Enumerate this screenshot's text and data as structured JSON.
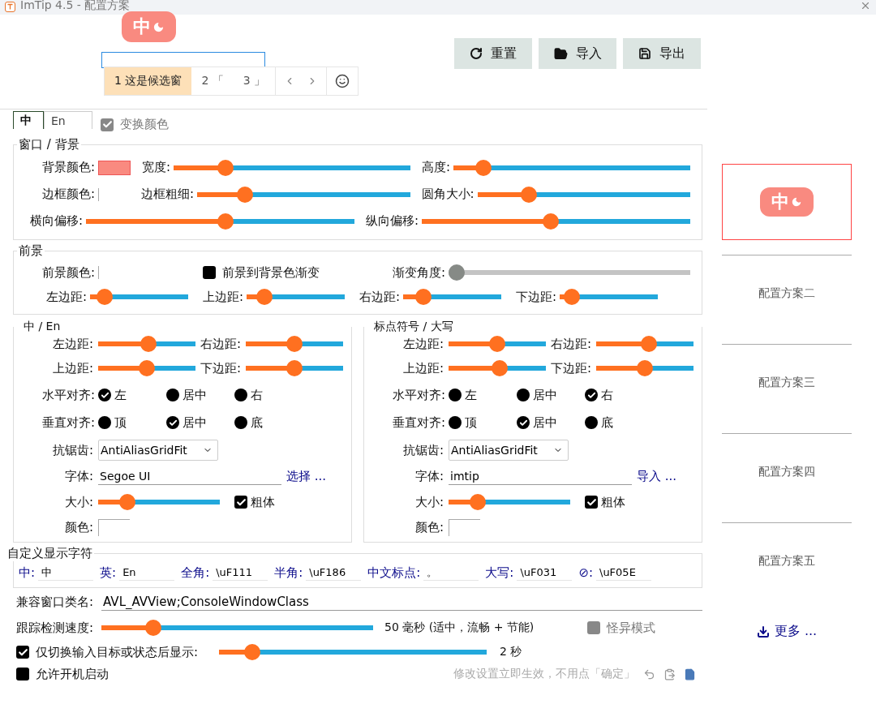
{
  "window": {
    "title": "ImTip 4.5 - 配置方案"
  },
  "badge": {
    "text": "中"
  },
  "candidates": [
    {
      "index": "1",
      "text": "这是候选窗",
      "selected": true
    },
    {
      "index": "2",
      "text": "「",
      "selected": false
    },
    {
      "index": "3",
      "text": "」",
      "selected": false
    }
  ],
  "toolbar": [
    {
      "kind": "reset",
      "label": "重置"
    },
    {
      "kind": "import",
      "label": "导入"
    },
    {
      "kind": "export",
      "label": "导出"
    }
  ],
  "tabs": [
    {
      "label": "中",
      "selected": true
    },
    {
      "label": "En",
      "selected": false
    }
  ],
  "swap_color": {
    "label": "变换颜色",
    "checked": true,
    "disabled": true
  },
  "background": {
    "title": "窗口 / 背景",
    "rows": [
      [
        {
          "kind": "color",
          "label": "背景颜色:",
          "color": "#f98a80"
        },
        {
          "kind": "slider",
          "label": "宽度:",
          "level": 0.2
        },
        {
          "kind": "slider",
          "label": "高度:",
          "level": 0.1
        }
      ],
      [
        {
          "kind": "color",
          "label": "边框颜色:",
          "color": "#ffffff"
        },
        {
          "kind": "slider",
          "label": "边框粗细:",
          "level": 0.2
        },
        {
          "kind": "slider",
          "label": "圆角大小:",
          "level": 0.22
        }
      ],
      [
        {
          "kind": "slider",
          "label": "横向偏移:",
          "level": 0.52
        },
        {
          "kind": "slider",
          "label": "纵向偏移:",
          "level": 0.48
        }
      ]
    ]
  },
  "foreground": {
    "title": "前景",
    "rows": [
      [
        {
          "kind": "color",
          "label": "前景颜色:",
          "color": "#ffffff"
        },
        {
          "kind": "checkbox",
          "label": "前景到背景色渐变",
          "checked": false
        },
        {
          "kind": "slider",
          "label": "渐变角度:",
          "level": 0,
          "disabled": true
        }
      ],
      [
        {
          "kind": "slider",
          "label": "左边距:",
          "level": 0.08
        },
        {
          "kind": "slider",
          "label": "上边距:",
          "level": 0.12
        },
        {
          "kind": "slider",
          "label": "右边距:",
          "level": 0.15
        },
        {
          "kind": "slider",
          "label": "下边距:",
          "level": 0.05
        }
      ]
    ]
  },
  "text_panels": [
    {
      "title": "中 / En",
      "margins": [
        {
          "label": "左边距:",
          "level": 0.52
        },
        {
          "label": "右边距:",
          "level": 0.5
        },
        {
          "label": "上边距:",
          "level": 0.5
        },
        {
          "label": "下边距:",
          "level": 0.5
        }
      ],
      "h_align": {
        "label": "水平对齐:",
        "options": [
          {
            "label": "左",
            "selected": true
          },
          {
            "label": "居中",
            "selected": false
          },
          {
            "label": "右",
            "selected": false
          }
        ]
      },
      "v_align": {
        "label": "垂直对齐:",
        "options": [
          {
            "label": "顶",
            "selected": false
          },
          {
            "label": "居中",
            "selected": true
          },
          {
            "label": "底",
            "selected": false
          }
        ]
      },
      "antialias": {
        "label": "抗锯齿:",
        "value": "AntiAliasGridFit"
      },
      "font": {
        "label": "字体:",
        "value": "Segoe UI",
        "link": "选择 ..."
      },
      "size": {
        "label": "大小:",
        "level": 0.2
      },
      "bold": {
        "label": "粗体",
        "checked": true
      },
      "color": {
        "label": "颜色:",
        "color": "#ffffff"
      }
    },
    {
      "title": "标点符号 / 大写",
      "margins": [
        {
          "label": "左边距:",
          "level": 0.5
        },
        {
          "label": "右边距:",
          "level": 0.55
        },
        {
          "label": "上边距:",
          "level": 0.53
        },
        {
          "label": "下边距:",
          "level": 0.5
        }
      ],
      "h_align": {
        "label": "水平对齐:",
        "options": [
          {
            "label": "左",
            "selected": false
          },
          {
            "label": "居中",
            "selected": false
          },
          {
            "label": "右",
            "selected": true
          }
        ]
      },
      "v_align": {
        "label": "垂直对齐:",
        "options": [
          {
            "label": "顶",
            "selected": false
          },
          {
            "label": "居中",
            "selected": true
          },
          {
            "label": "底",
            "selected": false
          }
        ]
      },
      "antialias": {
        "label": "抗锯齿:",
        "value": "AntiAliasGridFit"
      },
      "font": {
        "label": "字体:",
        "value": "imtip",
        "link": "导入 ..."
      },
      "size": {
        "label": "大小:",
        "level": 0.2
      },
      "bold": {
        "label": "粗体",
        "checked": true
      },
      "color": {
        "label": "颜色:",
        "color": "#ffffff"
      }
    }
  ],
  "custom_chars": {
    "title": "自定义显示字符",
    "fields": [
      {
        "label": "中:",
        "value": "中"
      },
      {
        "label": "英:",
        "value": "En"
      },
      {
        "label": "全角:",
        "value": "\\uF111"
      },
      {
        "label": "半角:",
        "value": "\\uF186"
      },
      {
        "label": "中文标点:",
        "value": "。"
      },
      {
        "label": "大写:",
        "value": "\\uF031"
      },
      {
        "label": "⊘:",
        "value": "\\uF05E"
      }
    ]
  },
  "class_name": {
    "label": "兼容窗口类名:",
    "value": "AVL_AVView;ConsoleWindowClass"
  },
  "tracking": {
    "label": "跟踪检测速度:",
    "level": 0.17,
    "reading": "50 毫秒  (适中，流畅 + 节能)"
  },
  "weird_mode": {
    "label": "怪异模式",
    "checked": false,
    "disabled": true
  },
  "only_switch": {
    "label": "仅切换输入目标或状态后显示:",
    "checked": true,
    "level": 0.1,
    "reading": "2 秒"
  },
  "autostart": {
    "label": "允许开机启动",
    "checked": false
  },
  "note": "修改设置立即生效，不用点「确定」",
  "schemes": [
    {
      "kind": "preview",
      "badge": "中",
      "selected": true
    },
    {
      "kind": "named",
      "label": "配置方案二",
      "selected": false
    },
    {
      "kind": "named",
      "label": "配置方案三",
      "selected": false
    },
    {
      "kind": "named",
      "label": "配置方案四",
      "selected": false
    },
    {
      "kind": "named",
      "label": "配置方案五",
      "selected": false
    }
  ],
  "more_link": "更多 ..."
}
